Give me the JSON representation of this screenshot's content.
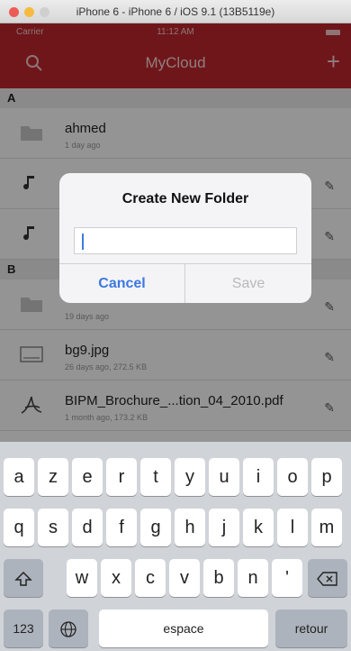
{
  "simulator": {
    "title": "iPhone 6 - iPhone 6 / iOS 9.1 (13B5119e)"
  },
  "status_bar": {
    "carrier": "Carrier",
    "time": "11:12 AM"
  },
  "nav": {
    "title": "MyCloud"
  },
  "list": {
    "sections": [
      {
        "letter": "A",
        "rows": [
          {
            "name": "ahmed",
            "meta": "1 day ago",
            "icon": "folder-icon"
          },
          {
            "name": "",
            "meta": "",
            "icon": "music-note-icon"
          },
          {
            "name": "",
            "meta": "",
            "icon": "music-note-icon"
          }
        ]
      },
      {
        "letter": "B",
        "rows": [
          {
            "name": "",
            "meta": "19 days ago",
            "icon": "folder-icon"
          },
          {
            "name": "bg9.jpg",
            "meta": "26 days ago, 272.5 KB",
            "icon": "image-icon"
          },
          {
            "name": "BIPM_Brochure_...tion_04_2010.pdf",
            "meta": "1 month ago, 173.2 KB",
            "icon": "pdf-icon"
          }
        ]
      }
    ]
  },
  "dialog": {
    "title": "Create New Folder",
    "input_value": "",
    "cancel": "Cancel",
    "save": "Save"
  },
  "keyboard": {
    "row1": [
      "a",
      "z",
      "e",
      "r",
      "t",
      "y",
      "u",
      "i",
      "o",
      "p"
    ],
    "row2": [
      "q",
      "s",
      "d",
      "f",
      "g",
      "h",
      "j",
      "k",
      "l",
      "m"
    ],
    "row3": [
      "w",
      "x",
      "c",
      "v",
      "b",
      "n",
      "'"
    ],
    "numbers": "123",
    "space": "espace",
    "return": "retour"
  }
}
